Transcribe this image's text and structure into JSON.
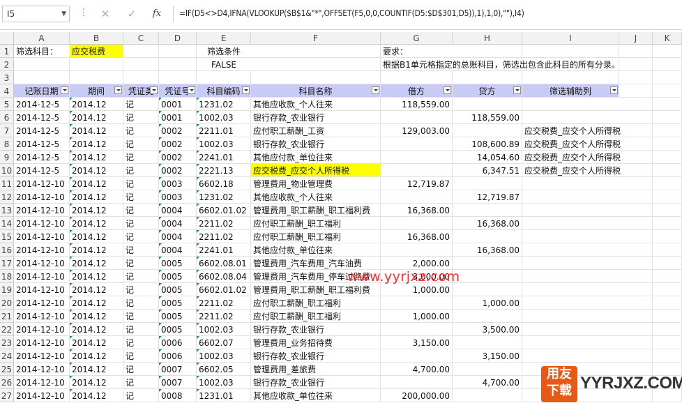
{
  "formula_bar": {
    "name_box": "I5",
    "formula": "=IF(D5<>D4,IFNA(VLOOKUP($B$1&\"*\",OFFSET(F5,0,0,COUNTIF(D5:$D$301,D5)),1),1,0),\"\"),I4)"
  },
  "columns": [
    "A",
    "B",
    "C",
    "D",
    "E",
    "F",
    "G",
    "H",
    "I",
    "J",
    "K"
  ],
  "row1": {
    "a": "筛选科目：",
    "b": "应交税费",
    "e": "筛选条件",
    "g": "要求："
  },
  "row2": {
    "e": "FALSE",
    "g": "根据B1单元格指定的总账科目，筛选出包含此科目的所有分录。"
  },
  "headers": [
    "记账日期",
    "期间",
    "凭证类",
    "凭证号",
    "科目编码",
    "科目名称",
    "借方",
    "贷方",
    "筛选辅助列"
  ],
  "rows": [
    {
      "n": "5",
      "a": "2014-12-5",
      "b": "2014.12",
      "c": "记",
      "d": "0001",
      "e": "1231.02",
      "f": "其他应收款_个人往来",
      "g": "118,559.00",
      "h": "",
      "i": ""
    },
    {
      "n": "6",
      "a": "2014-12-5",
      "b": "2014.12",
      "c": "记",
      "d": "0001",
      "e": "1002.03",
      "f": "银行存款_农业银行",
      "g": "",
      "h": "118,559.00",
      "i": ""
    },
    {
      "n": "7",
      "a": "2014-12-5",
      "b": "2014.12",
      "c": "记",
      "d": "0002",
      "e": "2211.01",
      "f": "应付职工薪酬_工资",
      "g": "129,003.00",
      "h": "",
      "i": "应交税费_应交个人所得税"
    },
    {
      "n": "8",
      "a": "2014-12-5",
      "b": "2014.12",
      "c": "记",
      "d": "0002",
      "e": "1002.03",
      "f": "银行存款_农业银行",
      "g": "",
      "h": "108,600.89",
      "i": "应交税费_应交个人所得税"
    },
    {
      "n": "9",
      "a": "2014-12-5",
      "b": "2014.12",
      "c": "记",
      "d": "0002",
      "e": "2241.01",
      "f": "其他应付款_单位往来",
      "g": "",
      "h": "14,054.60",
      "i": "应交税费_应交个人所得税"
    },
    {
      "n": "10",
      "a": "2014-12-5",
      "b": "2014.12",
      "c": "记",
      "d": "0002",
      "e": "2221.13",
      "f": "应交税费_应交个人所得税",
      "g": "",
      "h": "6,347.51",
      "i": "应交税费_应交个人所得税"
    },
    {
      "n": "11",
      "a": "2014-12-10",
      "b": "2014.12",
      "c": "记",
      "d": "0003",
      "e": "6602.18",
      "f": "管理费用_物业管理费",
      "g": "12,719.87",
      "h": "",
      "i": ""
    },
    {
      "n": "12",
      "a": "2014-12-10",
      "b": "2014.12",
      "c": "记",
      "d": "0003",
      "e": "1231.02",
      "f": "其他应收款_个人往来",
      "g": "",
      "h": "12,719.87",
      "i": ""
    },
    {
      "n": "13",
      "a": "2014-12-10",
      "b": "2014.12",
      "c": "记",
      "d": "0004",
      "e": "6602.01.02",
      "f": "管理费用_职工薪酬_职工福利费",
      "g": "16,368.00",
      "h": "",
      "i": ""
    },
    {
      "n": "14",
      "a": "2014-12-10",
      "b": "2014.12",
      "c": "记",
      "d": "0004",
      "e": "2211.02",
      "f": "应付职工薪酬_职工福利",
      "g": "",
      "h": "16,368.00",
      "i": ""
    },
    {
      "n": "15",
      "a": "2014-12-10",
      "b": "2014.12",
      "c": "记",
      "d": "0004",
      "e": "2211.02",
      "f": "应付职工薪酬_职工福利",
      "g": "16,368.00",
      "h": "",
      "i": ""
    },
    {
      "n": "16",
      "a": "2014-12-10",
      "b": "2014.12",
      "c": "记",
      "d": "0004",
      "e": "2241.01",
      "f": "其他应付款_单位往来",
      "g": "",
      "h": "16,368.00",
      "i": ""
    },
    {
      "n": "17",
      "a": "2014-12-10",
      "b": "2014.12",
      "c": "记",
      "d": "0005",
      "e": "6602.08.01",
      "f": "管理费用_汽车费用_汽车油费",
      "g": "2,000.00",
      "h": "",
      "i": ""
    },
    {
      "n": "18",
      "a": "2014-12-10",
      "b": "2014.12",
      "c": "记",
      "d": "0005",
      "e": "6602.08.04",
      "f": "管理费用_汽车费用_停车过路费",
      "g": "3,000.00",
      "h": "",
      "i": ""
    },
    {
      "n": "19",
      "a": "2014-12-10",
      "b": "2014.12",
      "c": "记",
      "d": "0005",
      "e": "6602.01.02",
      "f": "管理费用_职工薪酬_职工福利费",
      "g": "1,000.00",
      "h": "",
      "i": ""
    },
    {
      "n": "20",
      "a": "2014-12-10",
      "b": "2014.12",
      "c": "记",
      "d": "0005",
      "e": "2211.02",
      "f": "应付职工薪酬_职工福利",
      "g": "",
      "h": "1,000.00",
      "i": ""
    },
    {
      "n": "21",
      "a": "2014-12-10",
      "b": "2014.12",
      "c": "记",
      "d": "0005",
      "e": "2211.02",
      "f": "应付职工薪酬_职工福利",
      "g": "1,000.00",
      "h": "",
      "i": ""
    },
    {
      "n": "22",
      "a": "2014-12-10",
      "b": "2014.12",
      "c": "记",
      "d": "0005",
      "e": "1002.03",
      "f": "银行存款_农业银行",
      "g": "",
      "h": "3,500.00",
      "i": ""
    },
    {
      "n": "23",
      "a": "2014-12-10",
      "b": "2014.12",
      "c": "记",
      "d": "0006",
      "e": "6602.07",
      "f": "管理费用_业务招待费",
      "g": "3,150.00",
      "h": "",
      "i": ""
    },
    {
      "n": "24",
      "a": "2014-12-10",
      "b": "2014.12",
      "c": "记",
      "d": "0006",
      "e": "1002.03",
      "f": "银行存款_农业银行",
      "g": "",
      "h": "3,150.00",
      "i": ""
    },
    {
      "n": "25",
      "a": "2014-12-10",
      "b": "2014.12",
      "c": "记",
      "d": "0007",
      "e": "6602.05",
      "f": "管理费用_差旅费",
      "g": "4,700.00",
      "h": "",
      "i": ""
    },
    {
      "n": "26",
      "a": "2014-12-10",
      "b": "2014.12",
      "c": "记",
      "d": "0007",
      "e": "1002.03",
      "f": "银行存款_农业银行",
      "g": "",
      "h": "4,700.00",
      "i": ""
    },
    {
      "n": "27",
      "a": "2014-12-10",
      "b": "2014.12",
      "c": "记",
      "d": "0008",
      "e": "1231.01",
      "f": "其他应收款_单位往来",
      "g": "200,000.00",
      "h": "",
      "i": ""
    }
  ],
  "watermark": "www.yyrjxz.com",
  "logo": {
    "badge_top": "用友",
    "badge_bottom": "下载",
    "text": "YYRJXZ.COM"
  }
}
